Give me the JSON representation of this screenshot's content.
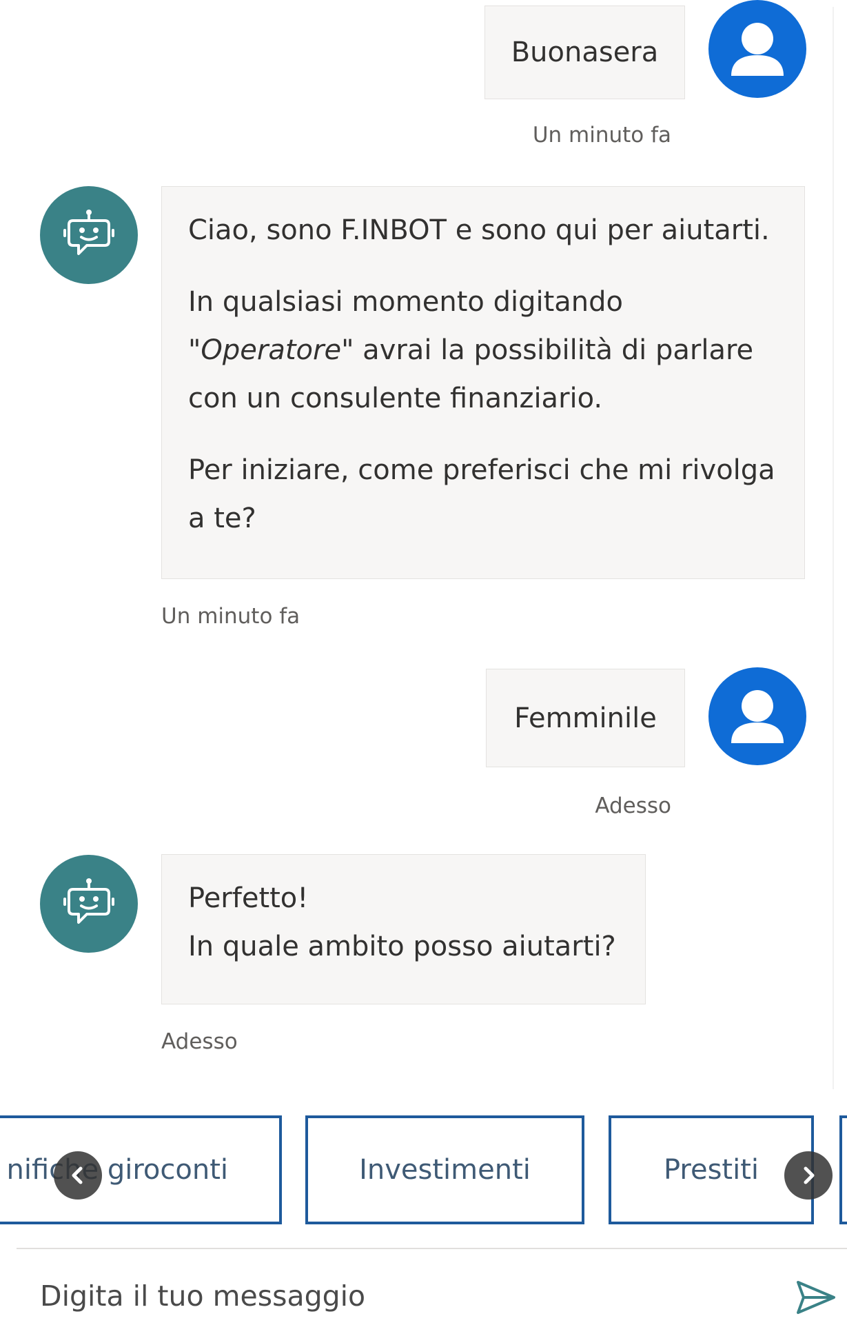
{
  "messages": [
    {
      "from": "user",
      "text": "Buonasera",
      "time": "Un minuto fa"
    },
    {
      "from": "bot",
      "paragraphs": [
        {
          "text": "Ciao, sono F.INBOT e sono qui per aiutarti."
        },
        {
          "before": "In qualsiasi momento digitando \"",
          "italic": "Operatore",
          "after": "\" avrai la possibilità di parlare con un consulente finanziario."
        },
        {
          "text": "Per iniziare, come preferisci che mi rivolga a te?"
        }
      ],
      "time": "Un minuto fa"
    },
    {
      "from": "user",
      "text": "Femminile",
      "time": "Adesso"
    },
    {
      "from": "bot",
      "lines": [
        "Perfetto!",
        "In quale ambito posso aiutarti?"
      ],
      "time": "Adesso"
    }
  ],
  "suggested_actions": [
    "nifiche giroconti",
    "Investimenti",
    "Prestiti"
  ],
  "composer": {
    "placeholder": "Digita il tuo messaggio"
  },
  "colors": {
    "user_avatar": "#0f6cd6",
    "bot_avatar": "#3a8287",
    "bubble": "#f7f6f5",
    "action_border": "#1e5a9c"
  },
  "icons": {
    "user_avatar": "person-icon",
    "bot_avatar": "robot-chat-icon",
    "prev": "chevron-left-icon",
    "next": "chevron-right-icon",
    "send": "send-icon"
  }
}
